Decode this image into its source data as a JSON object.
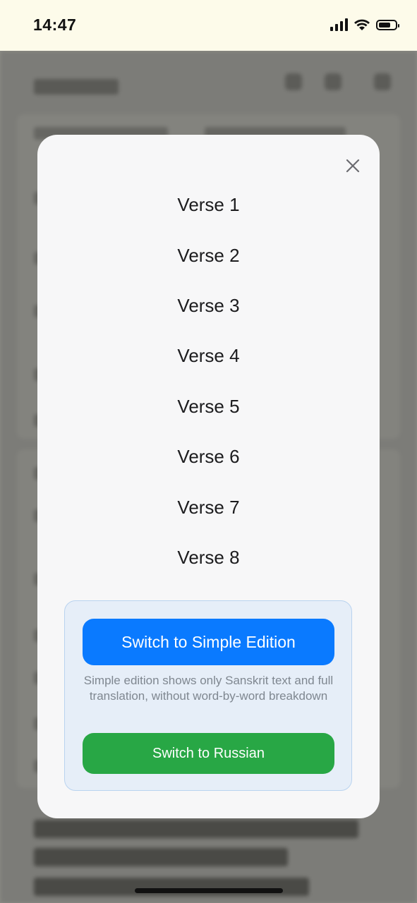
{
  "status_bar": {
    "time": "14:47",
    "icons": [
      "signal-icon",
      "wifi-icon",
      "battery-icon"
    ]
  },
  "modal": {
    "close_icon": "close-icon",
    "verses": [
      {
        "label": "Verse 1"
      },
      {
        "label": "Verse 2"
      },
      {
        "label": "Verse 3"
      },
      {
        "label": "Verse 4"
      },
      {
        "label": "Verse 5"
      },
      {
        "label": "Verse 6"
      },
      {
        "label": "Verse 7"
      },
      {
        "label": "Verse 8"
      }
    ],
    "options": {
      "simple_edition_label": "Switch to Simple Edition",
      "simple_edition_description": "Simple edition shows only Sanskrit text and full translation, without word-by-word breakdown",
      "russian_label": "Switch to Russian"
    }
  },
  "colors": {
    "primary_button": "#0a7aff",
    "secondary_button": "#28a745",
    "options_background": "#e6eef8"
  }
}
